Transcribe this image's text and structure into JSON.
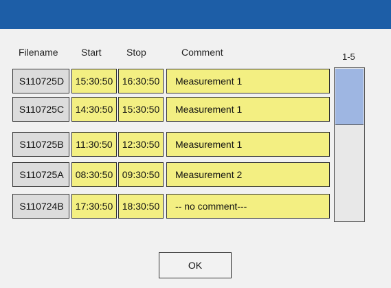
{
  "dialog": {
    "headers": {
      "filename": "Filename",
      "start": "Start",
      "stop": "Stop",
      "comment": "Comment"
    },
    "page_range": "1-5",
    "rows": [
      {
        "filename": "S110725D",
        "start": "15:30:50",
        "stop": "16:30:50",
        "comment": "Measurement 1"
      },
      {
        "filename": "S110725C",
        "start": "14:30:50",
        "stop": "15:30:50",
        "comment": "Measurement 1"
      },
      {
        "filename": "S110725B",
        "start": "11:30:50",
        "stop": "12:30:50",
        "comment": "Measurement 1"
      },
      {
        "filename": "S110725A",
        "start": "08:30:50",
        "stop": "09:30:50",
        "comment": "Measurement 2"
      },
      {
        "filename": "S110724B",
        "start": "17:30:50",
        "stop": "18:30:50",
        "comment": "-- no comment---"
      }
    ],
    "ok_label": "OK",
    "scroll_thumb_fraction": 0.37
  },
  "colors": {
    "titlebar": "#1d5ea7",
    "cell_yellow": "#f3ef82",
    "cell_gray": "#dcdcdc",
    "scroll_thumb": "#9eb6e2"
  }
}
